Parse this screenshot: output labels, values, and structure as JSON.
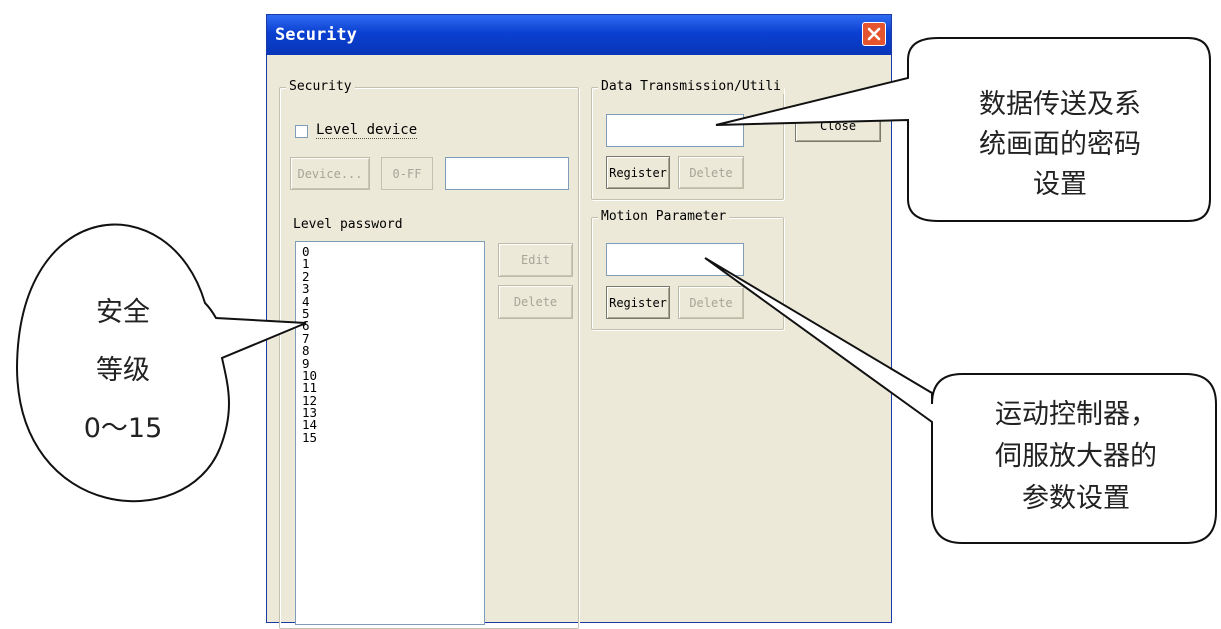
{
  "window": {
    "title": "Security",
    "close_icon": "close-icon"
  },
  "security_group": {
    "legend": "Security",
    "level_device_label": "Level device",
    "level_device_checked": false,
    "device_button": "Device...",
    "range_label": "0-FF",
    "device_value": ""
  },
  "level_password": {
    "label": "Level password",
    "items": [
      "0",
      "1",
      "2",
      "3",
      "4",
      "5",
      "6",
      "7",
      "8",
      "9",
      "10",
      "11",
      "12",
      "13",
      "14",
      "15"
    ],
    "edit_button": "Edit",
    "delete_button": "Delete"
  },
  "data_transmission_group": {
    "legend": "Data Transmission/Utili",
    "password_value": "",
    "register_button": "Register",
    "delete_button": "Delete"
  },
  "motion_group": {
    "legend": "Motion Parameter",
    "password_value": "",
    "register_button": "Register",
    "delete_button": "Delete"
  },
  "close_button": "Close",
  "callouts": {
    "left": {
      "line1": "安全",
      "line2": "等级",
      "line3": "0～15"
    },
    "top_right": {
      "line1": "数据传送及系",
      "line2": "统画面的密码",
      "line3": "设置"
    },
    "bottom_right": {
      "line1": "运动控制器，",
      "line2": "伺服放大器的",
      "line3": "参数设置"
    }
  }
}
